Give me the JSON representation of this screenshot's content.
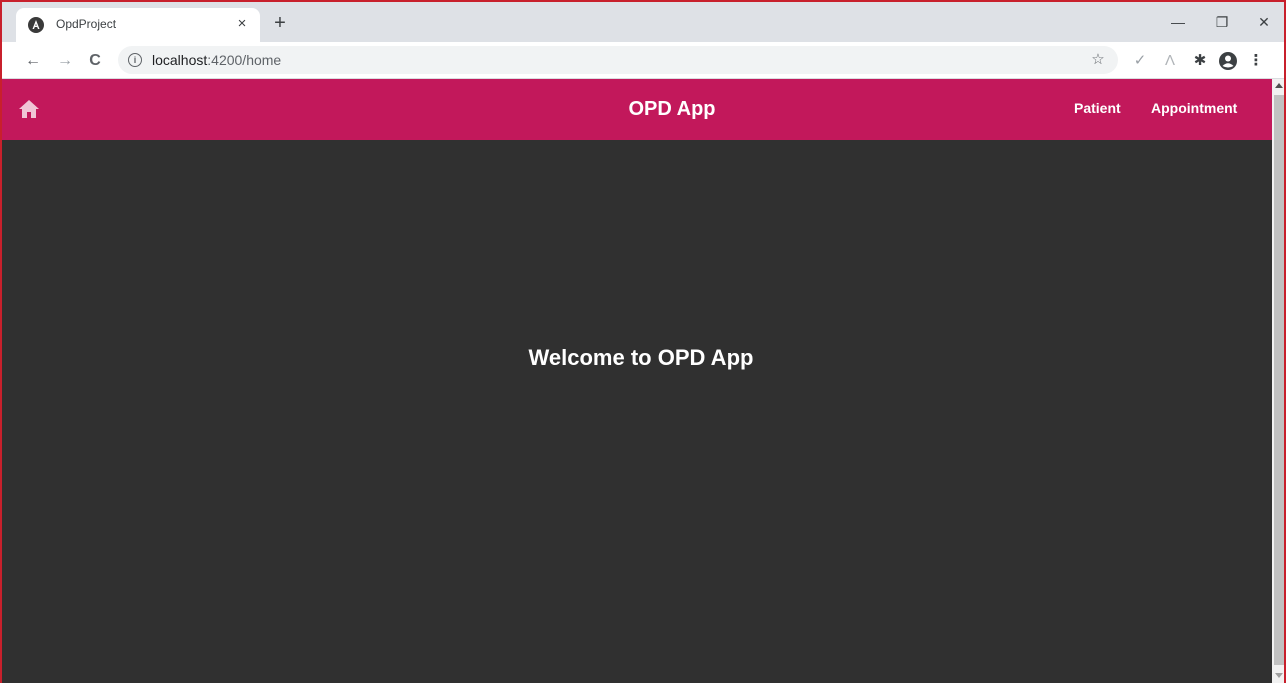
{
  "browser": {
    "tab": {
      "title": "OpdProject",
      "close_glyph": "×",
      "favicon": "angular-icon"
    },
    "new_tab_glyph": "+",
    "window_controls": {
      "minimize": "—",
      "restore": "❐",
      "close": "✕"
    },
    "nav": {
      "back": "←",
      "forward": "→",
      "reload": "C"
    },
    "address": {
      "host": "localhost",
      "path": ":4200/home"
    },
    "toolbar_icons": {
      "star": "☆",
      "check": "✓",
      "extension_a": "Λ",
      "puzzle": "✱",
      "menu": "⋮"
    }
  },
  "app": {
    "title": "OPD App",
    "nav_links": [
      {
        "label": "Patient"
      },
      {
        "label": "Appointment"
      }
    ],
    "welcome_text": "Welcome to OPD App"
  },
  "colors": {
    "header_bg": "#c2185b",
    "content_bg": "#303030",
    "frame_border": "#c8202c"
  }
}
